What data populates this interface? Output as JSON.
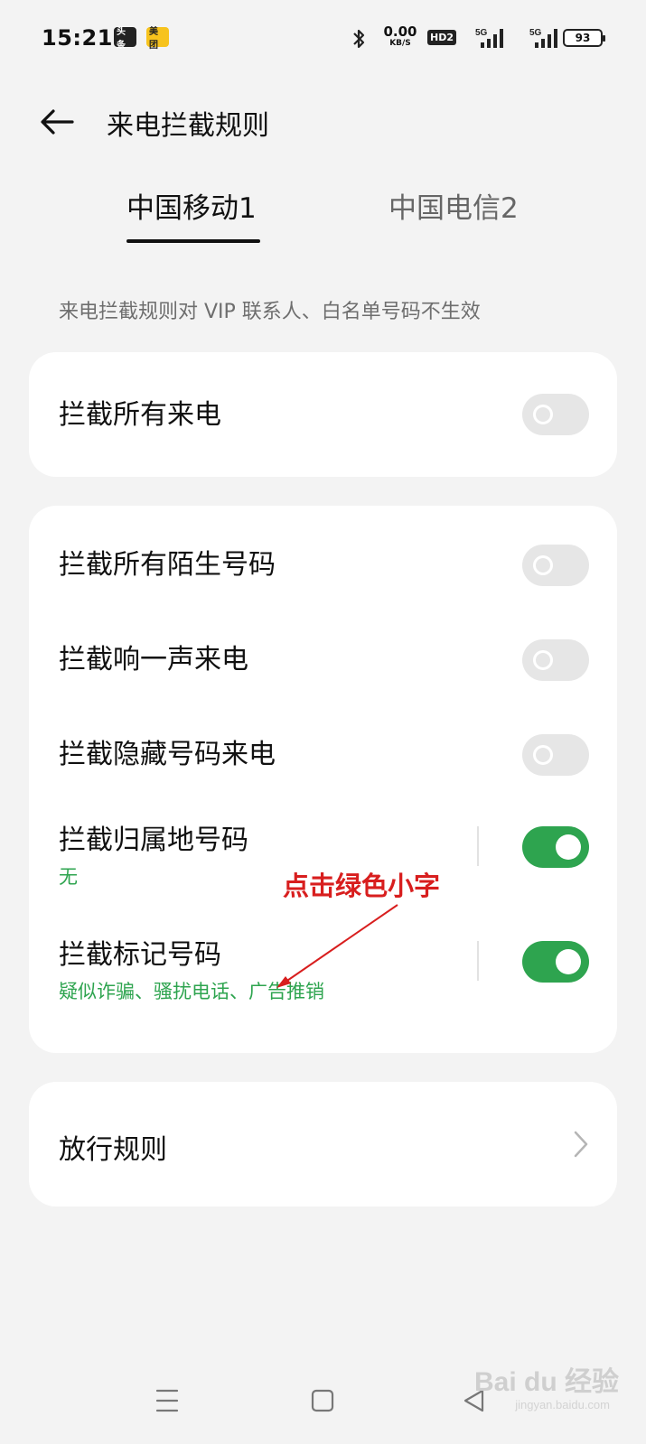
{
  "status_bar": {
    "time": "15:21",
    "badge_1": "头条",
    "badge_2": "美团",
    "net_speed_value": "0.00",
    "net_speed_unit": "KB/S",
    "hd_label": "HD2",
    "sim1_network": "5G",
    "sim2_network": "5G",
    "battery": "93"
  },
  "header": {
    "title": "来电拦截规则"
  },
  "tabs": [
    {
      "label": "中国移动1",
      "selected": true
    },
    {
      "label": "中国电信2",
      "selected": false
    }
  ],
  "note": "来电拦截规则对 VIP 联系人、白名单号码不生效",
  "card_block_all": {
    "title": "拦截所有来电",
    "enabled": false
  },
  "card_rules": [
    {
      "title": "拦截所有陌生号码",
      "enabled": false
    },
    {
      "title": "拦截响一声来电",
      "enabled": false
    },
    {
      "title": "拦截隐藏号码来电",
      "enabled": false
    },
    {
      "title": "拦截归属地号码",
      "subtitle": "无",
      "enabled": true
    },
    {
      "title": "拦截标记号码",
      "subtitle": "疑似诈骗、骚扰电话、广告推销",
      "enabled": true
    }
  ],
  "card_allow": {
    "title": "放行规则"
  },
  "annotation": {
    "text": "点击绿色小字",
    "color": "#d81e1e"
  },
  "colors": {
    "accent_green": "#2ea44f",
    "toggle_off": "#e6e6e6",
    "background": "#f3f3f3"
  },
  "watermark": {
    "logo": "Bai du 经验",
    "url": "jingyan.baidu.com"
  }
}
